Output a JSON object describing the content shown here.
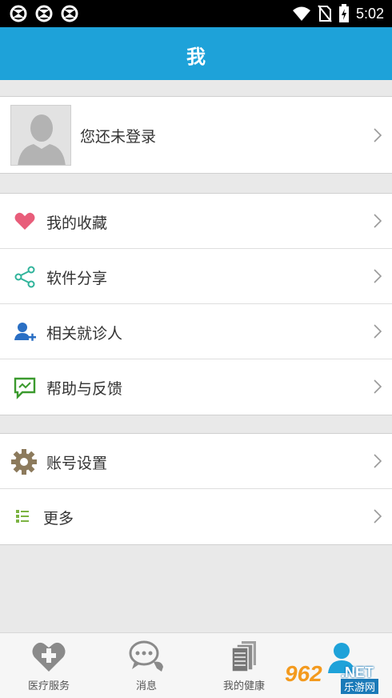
{
  "status_bar": {
    "time": "5:02",
    "left_icons": [
      "sync-icon",
      "sync-icon",
      "sync-icon"
    ],
    "right_icons": [
      "wifi-icon",
      "no-sim-icon",
      "battery-charging-icon"
    ]
  },
  "header": {
    "title": "我"
  },
  "profile": {
    "label": "您还未登录",
    "avatar_icon": "default-avatar-icon"
  },
  "menu_group_1": [
    {
      "label": "我的收藏",
      "icon": "heart-icon",
      "color": "#e85d7a"
    },
    {
      "label": "软件分享",
      "icon": "share-icon",
      "color": "#2fb39a"
    },
    {
      "label": "相关就诊人",
      "icon": "add-person-icon",
      "color": "#2a6fc4"
    },
    {
      "label": "帮助与反馈",
      "icon": "feedback-icon",
      "color": "#3b9a2e"
    }
  ],
  "menu_group_2": [
    {
      "label": "账号设置",
      "icon": "gear-icon",
      "color": "#8c7a5c"
    },
    {
      "label": "更多",
      "icon": "list-icon",
      "color": "#7cb342"
    }
  ],
  "bottom_nav": [
    {
      "label": "医疗服务",
      "icon": "medical-heart-icon"
    },
    {
      "label": "消息",
      "icon": "chat-bubble-icon"
    },
    {
      "label": "我的健康",
      "icon": "documents-icon"
    },
    {
      "label": "",
      "icon": "person-icon",
      "active": true
    }
  ],
  "watermark": {
    "number": "962",
    "suffix": ".NET",
    "site": "乐游网"
  },
  "colors": {
    "accent": "#1ea2d9",
    "background": "#e9e9e9"
  }
}
